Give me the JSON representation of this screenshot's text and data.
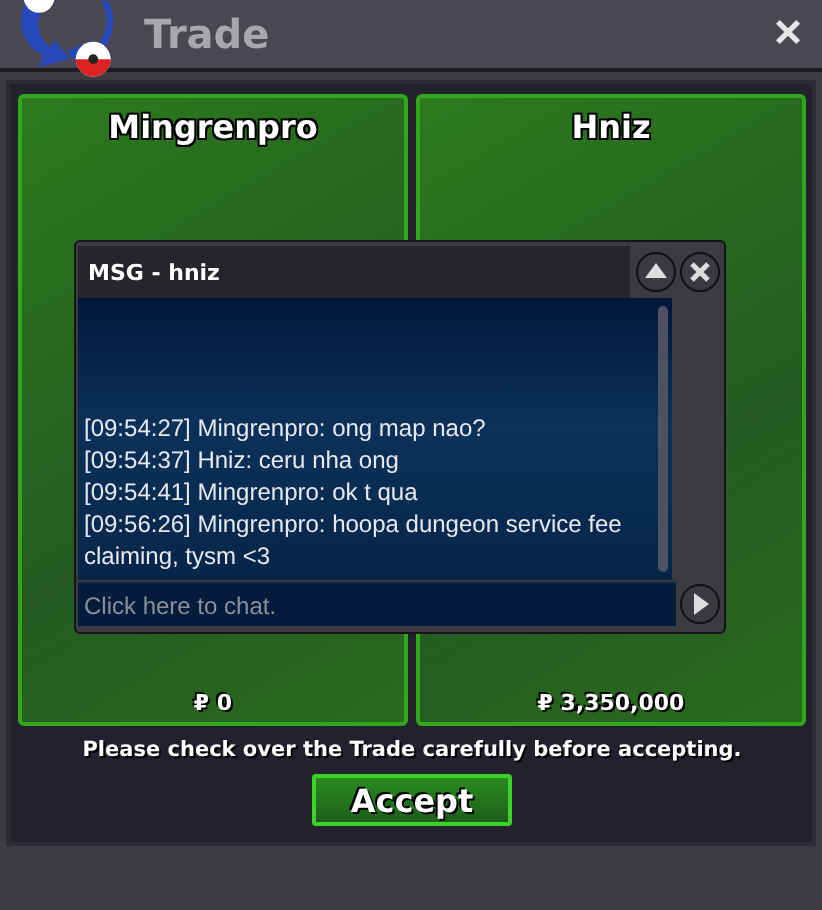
{
  "window": {
    "title": "Trade",
    "close": "×"
  },
  "panels": [
    {
      "name": "Mingrenpro",
      "money": "₽ 0"
    },
    {
      "name": "Hniz",
      "money": "₽ 3,350,000"
    }
  ],
  "notice": "Please check over the Trade carefully before accepting.",
  "accept_button": "Accept",
  "chat": {
    "title": "MSG - hniz",
    "messages": [
      "[09:54:27] Mingrenpro: ong map nao?",
      "[09:54:37] Hniz: ceru nha ong",
      "[09:54:41] Mingrenpro: ok t qua",
      "[09:56:26] Mingrenpro: hoopa dungeon service fee claiming, tysm <3"
    ],
    "placeholder": "Click here to chat."
  }
}
